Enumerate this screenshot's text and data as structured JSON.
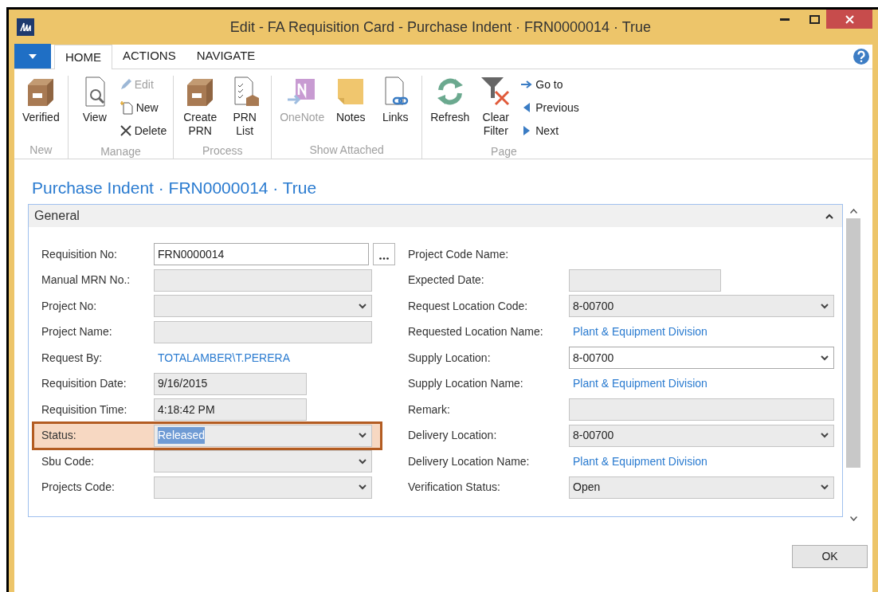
{
  "window": {
    "title": "Edit - FA Requisition Card - Purchase Indent · FRN0000014 · True"
  },
  "tabs": [
    {
      "label": "HOME",
      "selected": true
    },
    {
      "label": "ACTIONS",
      "selected": false
    },
    {
      "label": "NAVIGATE",
      "selected": false
    }
  ],
  "ribbon": [
    {
      "label": "New",
      "items": [
        {
          "kind": "large",
          "label": "Verified",
          "disabled": false
        }
      ]
    },
    {
      "label": "Manage",
      "items": [
        {
          "kind": "large",
          "label": "View",
          "disabled": false
        },
        {
          "kind": "small",
          "label": "Edit",
          "disabled": true
        },
        {
          "kind": "small",
          "label": "New",
          "disabled": false
        },
        {
          "kind": "small",
          "label": "Delete",
          "disabled": false
        }
      ]
    },
    {
      "label": "Process",
      "items": [
        {
          "kind": "large",
          "label": "Create PRN",
          "disabled": false
        },
        {
          "kind": "large",
          "label": "PRN List",
          "disabled": false
        }
      ]
    },
    {
      "label": "Show Attached",
      "items": [
        {
          "kind": "large",
          "label": "OneNote",
          "disabled": true
        },
        {
          "kind": "large",
          "label": "Notes",
          "disabled": false
        },
        {
          "kind": "large",
          "label": "Links",
          "disabled": false
        }
      ]
    },
    {
      "label": "Page",
      "items": [
        {
          "kind": "large",
          "label": "Refresh",
          "disabled": false
        },
        {
          "kind": "large",
          "label": "Clear Filter",
          "disabled": false
        },
        {
          "kind": "small",
          "label": "Go to",
          "disabled": false
        },
        {
          "kind": "small",
          "label": "Previous",
          "disabled": false
        },
        {
          "kind": "small",
          "label": "Next",
          "disabled": false
        }
      ]
    }
  ],
  "page_title": "Purchase Indent · FRN0000014 · True",
  "section": {
    "title": "General",
    "expanded": true
  },
  "left_fields": [
    {
      "label": "Requisition No:",
      "kind": "text",
      "editable": true,
      "lookup": true,
      "value": "FRN0000014"
    },
    {
      "label": "Manual MRN No.:",
      "kind": "text",
      "editable": false
    },
    {
      "label": "Project No:",
      "kind": "dropdown",
      "editable": false
    },
    {
      "label": "Project Name:",
      "kind": "text",
      "editable": false
    },
    {
      "label": "Request By:",
      "kind": "link",
      "value": "TOTALAMBER\\T.PERERA"
    },
    {
      "label": "Requisition Date:",
      "kind": "short",
      "editable": false,
      "value": "9/16/2015"
    },
    {
      "label": "Requisition Time:",
      "kind": "short",
      "editable": false,
      "value": "4:18:42 PM"
    },
    {
      "label": "Status:",
      "kind": "dropdown",
      "editable": false,
      "value": "Released",
      "highlighted": true,
      "text_selected": true
    },
    {
      "label": "Sbu Code:",
      "kind": "dropdown",
      "editable": false
    },
    {
      "label": "Projects Code:",
      "kind": "dropdown",
      "editable": false
    }
  ],
  "right_fields": [
    {
      "label": "Project Code Name:",
      "kind": "none"
    },
    {
      "label": "Expected Date:",
      "kind": "short",
      "editable": false
    },
    {
      "label": "Request Location Code:",
      "kind": "dropdown",
      "editable": false,
      "value": "8-00700"
    },
    {
      "label": "Requested Location Name:",
      "kind": "link",
      "value": "Plant & Equipment Division"
    },
    {
      "label": "Supply Location:",
      "kind": "dropdown",
      "editable": true,
      "value": "8-00700"
    },
    {
      "label": "Supply Location Name:",
      "kind": "link",
      "value": "Plant & Equipment Division"
    },
    {
      "label": "Remark:",
      "kind": "text",
      "editable": false
    },
    {
      "label": "Delivery Location:",
      "kind": "dropdown",
      "editable": false,
      "value": "8-00700"
    },
    {
      "label": "Delivery Location Name:",
      "kind": "link",
      "value": "Plant & Equipment Division"
    },
    {
      "label": "Verification Status:",
      "kind": "dropdown",
      "editable": false,
      "value": "Open"
    }
  ],
  "buttons": [
    "OK"
  ]
}
